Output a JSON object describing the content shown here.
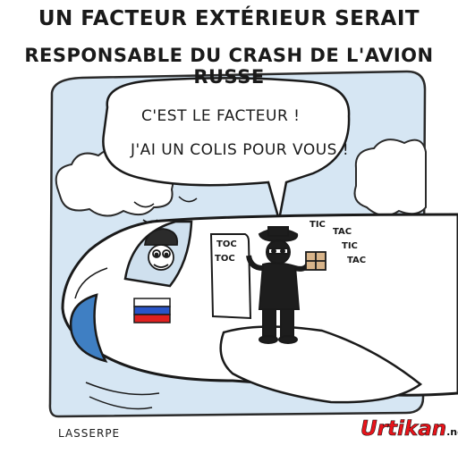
{
  "headline": {
    "line1": "UN FACTEUR EXTÉRIEUR SERAIT",
    "line2": "RESPONSABLE DU CRASH DE L'AVION RUSSE"
  },
  "speech_bubble": {
    "line1": "C'EST LE FACTEUR !",
    "line2": "J'AI UN COLIS POUR VOUS !"
  },
  "sound_effects": {
    "knock1": "TOC",
    "knock2": "TOC",
    "tick1": "TIC",
    "tack1": "TAC",
    "tick2": "TIC",
    "tack2": "TAC"
  },
  "signature": "LASSERPE",
  "brand": {
    "name": "Urtikan",
    "suffix": ".net",
    "color": "#e8141b"
  },
  "colors": {
    "sky": "#d6e6f3",
    "window_blue": "#3f7fc3",
    "flag_white": "#ffffff",
    "flag_blue": "#2a55c8",
    "flag_red": "#e02020",
    "package": "#d8b48a",
    "postman": "#1d1d1d"
  }
}
